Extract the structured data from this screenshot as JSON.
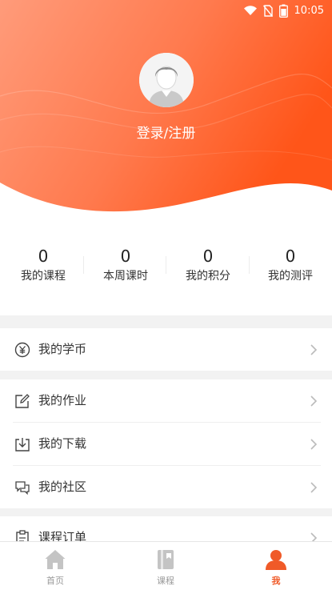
{
  "status_bar": {
    "time": "10:05"
  },
  "profile": {
    "login_label": "登录/注册"
  },
  "stats": [
    {
      "value": "0",
      "label": "我的课程"
    },
    {
      "value": "0",
      "label": "本周课时"
    },
    {
      "value": "0",
      "label": "我的积分"
    },
    {
      "value": "0",
      "label": "我的测评"
    }
  ],
  "menu": {
    "coins": "我的学币",
    "homework": "我的作业",
    "downloads": "我的下载",
    "community": "我的社区",
    "orders": "课程订单"
  },
  "tabbar": {
    "home": "首页",
    "courses": "课程",
    "me": "我"
  },
  "colors": {
    "accent": "#f05a28",
    "gradient_start": "#ff9a78",
    "gradient_end": "#ff5a1f"
  }
}
